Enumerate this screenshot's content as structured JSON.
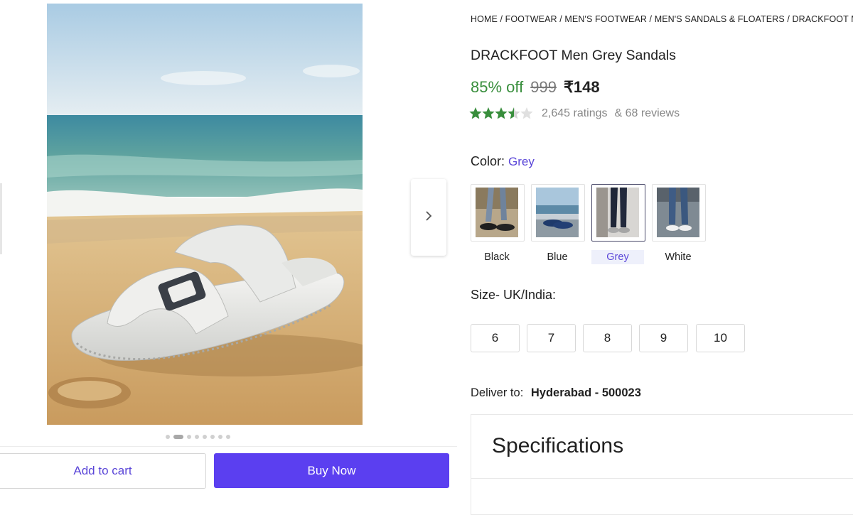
{
  "gallery": {
    "image_alt": "White sandal on beach",
    "dots_count": 9,
    "active_dot": 1
  },
  "actions": {
    "add_to_cart": "Add to cart",
    "buy_now": "Buy Now"
  },
  "breadcrumb": [
    "HOME",
    "FOOTWEAR",
    "MEN'S FOOTWEAR",
    "MEN'S SANDALS & FLOATERS",
    "DRACKFOOT MEN"
  ],
  "product": {
    "title": "DRACKFOOT Men Grey Sandals",
    "discount": "85% off",
    "mrp": "999",
    "price": "₹148",
    "rating_stars": 3.5,
    "ratings_text": "2,645 ratings",
    "reviews_text": "& 68 reviews"
  },
  "color": {
    "label": "Color:",
    "selected": "Grey",
    "options": [
      "Black",
      "Blue",
      "Grey",
      "White"
    ]
  },
  "size": {
    "label": "Size- UK/India:",
    "options": [
      "6",
      "7",
      "8",
      "9",
      "10"
    ]
  },
  "delivery": {
    "label": "Deliver to:",
    "location": "Hyderabad - 500023"
  },
  "specifications": {
    "title": "Specifications"
  },
  "colors": {
    "accent": "#5b3ff0",
    "discount_green": "#388e3c",
    "star_green": "#388e3c"
  },
  "icons": {
    "next": "chevron-right-icon",
    "star": "star-icon"
  }
}
